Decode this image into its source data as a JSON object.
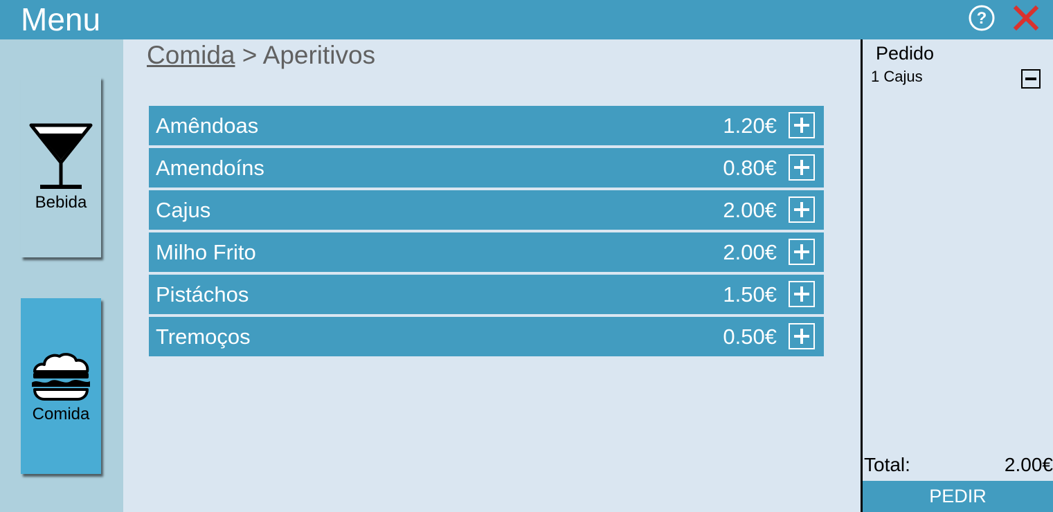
{
  "app": {
    "title": "Menu"
  },
  "toolbar": {
    "help_icon": "help-circle-icon",
    "close_icon": "close-x-icon",
    "close_color": "#d9322e"
  },
  "categories": [
    {
      "label": "Bebida",
      "icon": "cocktail-glass-icon",
      "selected": false
    },
    {
      "label": "Comida",
      "icon": "burger-icon",
      "selected": true
    }
  ],
  "breadcrumb": {
    "root": "Comida",
    "separator": ">",
    "current": "Aperitivos"
  },
  "items": [
    {
      "name": "Amêndoas",
      "price": "1.20€"
    },
    {
      "name": "Amendoíns",
      "price": "0.80€"
    },
    {
      "name": "Cajus",
      "price": "2.00€"
    },
    {
      "name": "Milho Frito",
      "price": "2.00€"
    },
    {
      "name": "Pistáchos",
      "price": "1.50€"
    },
    {
      "name": "Tremoços",
      "price": "0.50€"
    }
  ],
  "order": {
    "title": "Pedido",
    "lines": [
      {
        "text": "1 Cajus"
      }
    ],
    "total_label": "Total:",
    "total_value": "2.00€",
    "submit_label": "PEDIR"
  },
  "colors": {
    "primary": "#429cc0",
    "background": "#dae6f1",
    "sidebar": "#aed0dd",
    "selected_category": "#49acd4"
  }
}
